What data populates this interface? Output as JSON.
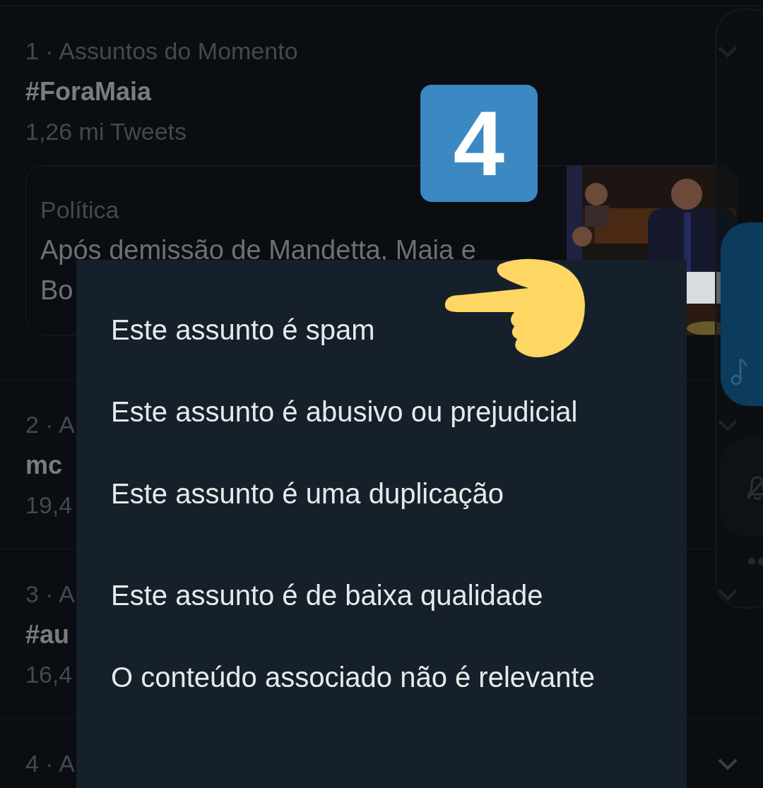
{
  "trends": [
    {
      "rank_line": "1 · Assuntos do Momento",
      "title": "#ForaMaia",
      "count": "1,26 mi Tweets",
      "card": {
        "category": "Política",
        "headline_lines": [
          "Após demissão de Mandetta, Maia e",
          "Bo"
        ]
      }
    },
    {
      "rank_line": "2 · A",
      "title": "mc",
      "count": "19,4"
    },
    {
      "rank_line": "3 · A",
      "title": "#au",
      "count": "16,4"
    },
    {
      "rank_line": "4 · A"
    }
  ],
  "menu": {
    "items": [
      {
        "label": "Este assunto é spam"
      },
      {
        "label": "Este assunto é abusivo ou prejudicial"
      },
      {
        "label": "Este assunto é uma duplicação"
      },
      {
        "label": "Este assunto é de baixa qualidade"
      },
      {
        "label": "O conteúdo associado não é relevante"
      }
    ]
  },
  "keycap": {
    "label": "4"
  }
}
